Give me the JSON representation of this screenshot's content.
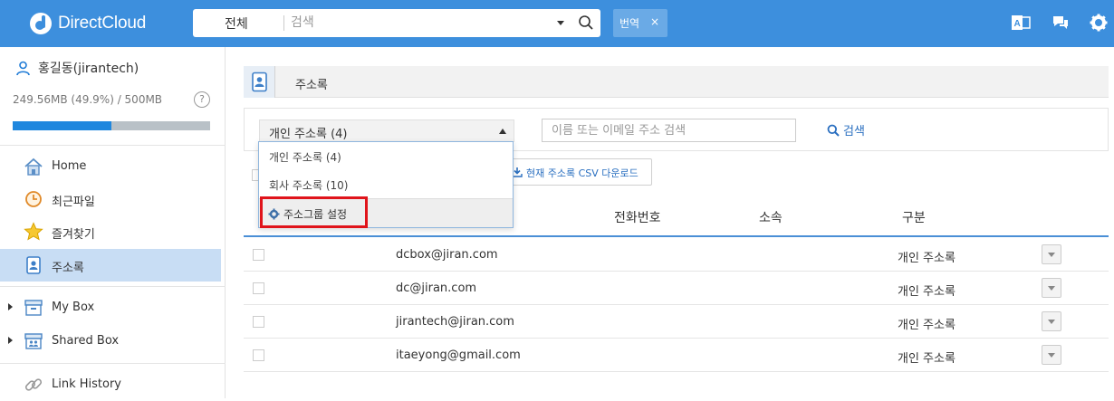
{
  "header": {
    "brand": "DirectCloud",
    "search_scope": "전체",
    "search_placeholder": "검색",
    "translate_label": "번역",
    "translate_close": "×"
  },
  "sidebar": {
    "user_name": "홍길동(jirantech)",
    "quota_text": "249.56MB (49.9%) / 500MB",
    "quota_help": "?",
    "quota_fraction": 0.499,
    "items": [
      {
        "label": "Home",
        "icon": "home-icon",
        "active": false
      },
      {
        "label": "최근파일",
        "icon": "clock-icon",
        "active": false
      },
      {
        "label": "즐겨찾기",
        "icon": "star-icon",
        "active": false
      },
      {
        "label": "주소록",
        "icon": "address-book-icon",
        "active": true
      },
      {
        "label": "My Box",
        "icon": "box-icon",
        "expandable": true
      },
      {
        "label": "Shared Box",
        "icon": "shared-box-icon",
        "expandable": true
      },
      {
        "label": "Link History",
        "icon": "link-icon",
        "active": false
      }
    ]
  },
  "main": {
    "page_title": "주소록",
    "group_select_value": "개인 주소록 (4)",
    "name_search_placeholder": "이름 또는 이메일 주소 검색",
    "search_label": "검색",
    "csv_download_label": "현재 주소록 CSV 다운로드",
    "columns": [
      "전화번호",
      "소속",
      "구분"
    ],
    "rows": [
      {
        "email": "dcbox@jiran.com",
        "kind": "개인 주소록"
      },
      {
        "email": "dc@jiran.com",
        "kind": "개인 주소록"
      },
      {
        "email": "jirantech@jiran.com",
        "kind": "개인 주소록"
      },
      {
        "email": "itaeyong@gmail.com",
        "kind": "개인 주소록"
      }
    ],
    "dropdown": {
      "options": [
        "개인 주소록 (4)",
        "회사 주소록 (10)"
      ],
      "setting_label": "주소그룹 설정"
    }
  },
  "colors": {
    "topbar": "#3d8fdd",
    "accent": "#1f87de",
    "highlight": "#e0141b"
  }
}
